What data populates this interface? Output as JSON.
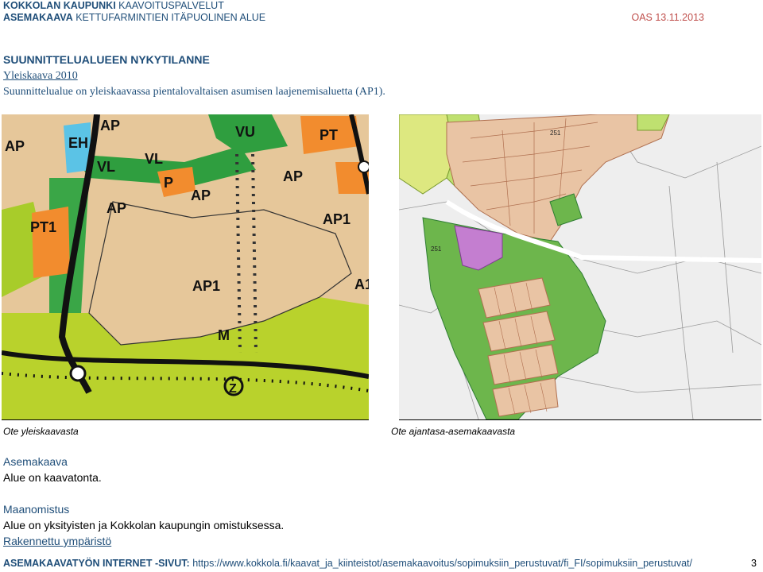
{
  "header": {
    "org_bold": "KOKKOLAN KAUPUNKI",
    "org_rest": "KAAVOITUSPALVELUT",
    "plan_bold": "ASEMAKAAVA",
    "plan_rest": "KETTUFARMINTIEN ITÄPUOLINEN ALUE",
    "oas": "OAS 13.11.2013"
  },
  "section": {
    "title": "SUUNNITTELUALUEEN NYKYTILANNE",
    "link": "Yleiskaava 2010",
    "text": "Suunnittelualue on yleiskaavassa pientalovaltaisen asumisen laajenemisaluetta (AP1)."
  },
  "maps": {
    "left_labels": [
      "AP",
      "EH",
      "AP",
      "VU",
      "PT",
      "VL",
      "VL",
      "P",
      "AP",
      "AP",
      "AP",
      "PT1",
      "AP1",
      "AP1",
      "A1",
      "M",
      "Z"
    ],
    "right_labels": [
      "251",
      "251"
    ],
    "caption_left": "Ote yleiskaavasta",
    "caption_right": "Ote ajantasa-asemakaavasta"
  },
  "asemakaava": {
    "heading": "Asemakaava",
    "text": "Alue on kaavatonta."
  },
  "maanomistus": {
    "heading": "Maanomistus",
    "text": "Alue on yksityisten ja Kokkolan kaupungin omistuksessa."
  },
  "rakennettu": {
    "heading": "Rakennettu ympäristö"
  },
  "footer": {
    "bold": "ASEMAKAAVATYÖN INTERNET -SIVUT:",
    "url": "https://www.kokkola.fi/kaavat_ja_kiinteistot/asemakaavoitus/sopimuksiin_perustuvat/fi_FI/sopimuksiin_perustuvat/",
    "page": "3"
  },
  "colors": {
    "heading_blue": "#1f4e79",
    "oas_red": "#c0504d",
    "residential": "#e8c9a0",
    "green": "#2ea043",
    "yellow_green": "#b8d42a",
    "orange": "#f08a2c"
  }
}
